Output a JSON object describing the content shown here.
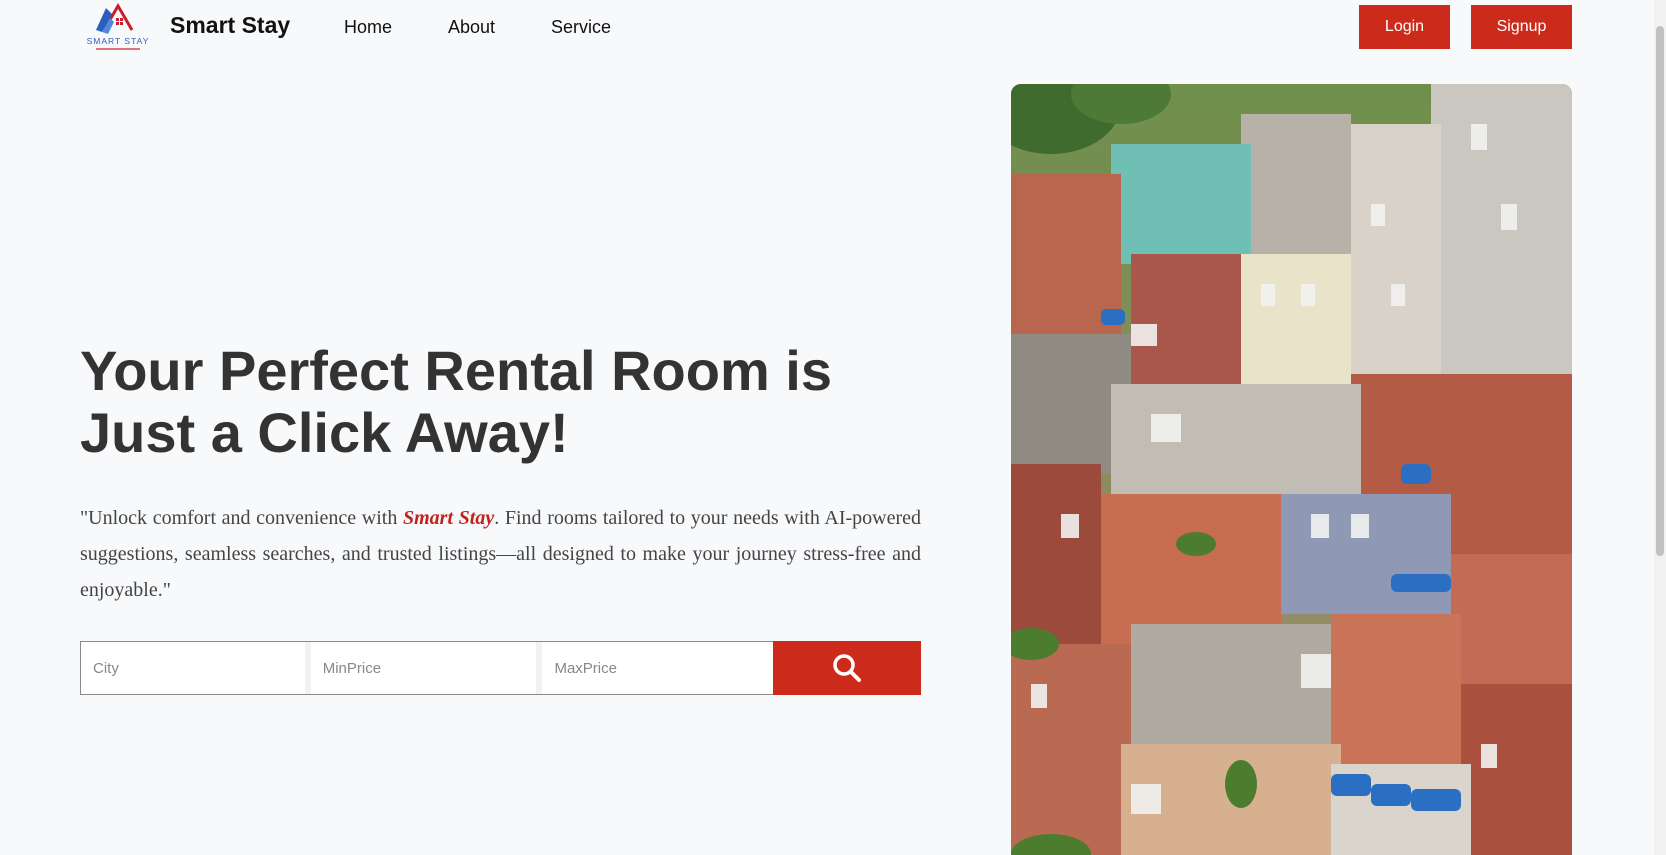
{
  "header": {
    "logo_text": "SMART STAY",
    "brand": "Smart Stay",
    "nav": [
      {
        "label": "Home"
      },
      {
        "label": "About"
      },
      {
        "label": "Service"
      }
    ],
    "login_label": "Login",
    "signup_label": "Signup"
  },
  "hero": {
    "title_line1": "Your Perfect Rental Room is",
    "title_line2": "Just a Click Away!",
    "desc_prefix": "\"Unlock comfort and convenience with ",
    "desc_brand": "Smart Stay",
    "desc_suffix": ". Find rooms tailored to your needs with AI-powered suggestions, seamless searches, and trusted listings—all designed to make your journey stress-free and enjoyable.\""
  },
  "search": {
    "city_placeholder": "City",
    "min_placeholder": "MinPrice",
    "max_placeholder": "MaxPrice",
    "button_icon": "search-icon"
  },
  "colors": {
    "accent": "#cc2a1b",
    "background": "#f8f9fb"
  }
}
